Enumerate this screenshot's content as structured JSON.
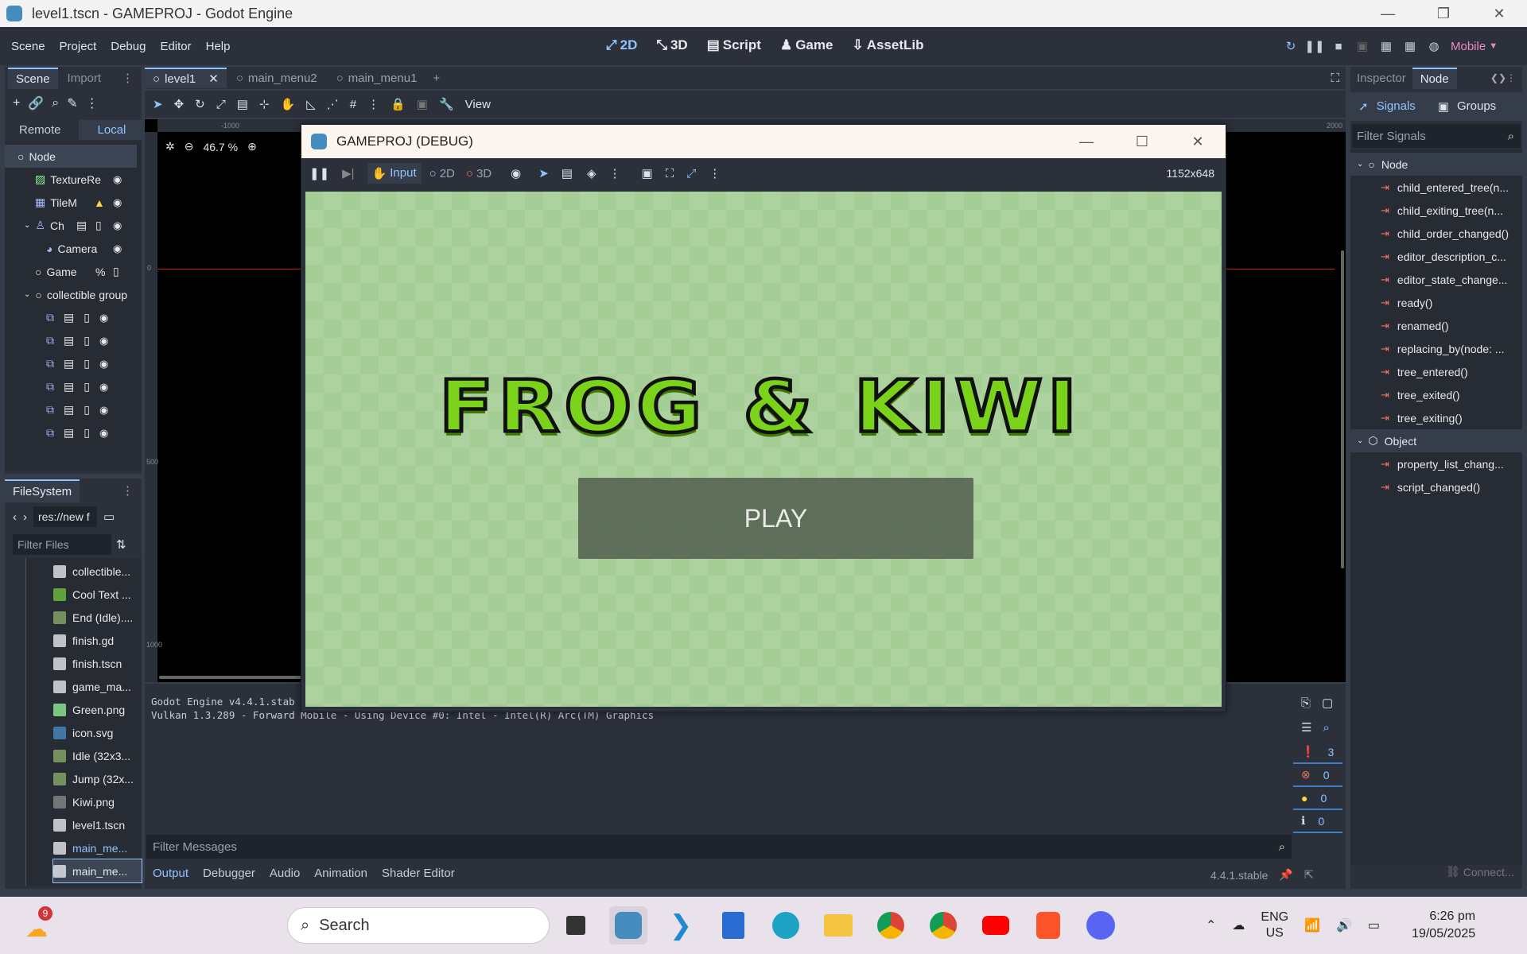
{
  "window": {
    "title": "level1.tscn - GAMEPROJ - Godot Engine"
  },
  "menu": [
    "Scene",
    "Project",
    "Debug",
    "Editor",
    "Help"
  ],
  "workspaces": [
    {
      "label": "2D",
      "active": true
    },
    {
      "label": "3D",
      "active": false
    },
    {
      "label": "Script",
      "active": false
    },
    {
      "label": "Game",
      "active": false
    },
    {
      "label": "AssetLib",
      "active": false
    }
  ],
  "renderer": "Mobile",
  "scene_dock": {
    "tabs": [
      "Scene",
      "Import"
    ],
    "remote": "Remote",
    "local": "Local",
    "nodes": [
      "Node",
      "TextureRe",
      "TileM",
      "Ch",
      "Camera",
      "Game",
      "collectible group"
    ]
  },
  "editor_tabs": [
    "level1",
    "main_menu2",
    "main_menu1"
  ],
  "canvas_toolbar": {
    "view": "View",
    "zoom": "46.7 %"
  },
  "rulers": {
    "top": [
      "-1000",
      "2000"
    ],
    "left": [
      "0",
      "500",
      "1000"
    ]
  },
  "game_window": {
    "title": "GAMEPROJ (DEBUG)",
    "input": "Input",
    "mode_2d": "2D",
    "mode_3d": "3D",
    "resolution": "1152x648",
    "logo_left": "FROG",
    "logo_amp": "&",
    "logo_right": "KIWI",
    "play": "PLAY"
  },
  "filesystem": {
    "tab": "FileSystem",
    "path": "res://new f",
    "filter_placeholder": "Filter Files",
    "files": [
      {
        "name": "collectible...",
        "color": "#e6e9ee"
      },
      {
        "name": "Cool Text ...",
        "color": "#e6e9ee"
      },
      {
        "name": "End (Idle)....",
        "color": "#e6e9ee"
      },
      {
        "name": "finish.gd",
        "color": "#e6e9ee"
      },
      {
        "name": "finish.tscn",
        "color": "#e6e9ee"
      },
      {
        "name": "game_ma...",
        "color": "#e6e9ee"
      },
      {
        "name": "Green.png",
        "color": "#e6e9ee"
      },
      {
        "name": "icon.svg",
        "color": "#e6e9ee"
      },
      {
        "name": "Idle (32x3...",
        "color": "#e6e9ee"
      },
      {
        "name": "Jump (32x...",
        "color": "#e6e9ee"
      },
      {
        "name": "Kiwi.png",
        "color": "#e6e9ee"
      },
      {
        "name": "level1.tscn",
        "color": "#e6e9ee"
      },
      {
        "name": "main_me...",
        "color": "#8fc5ff"
      },
      {
        "name": "main_me...",
        "color": "#e6e9ee"
      }
    ]
  },
  "output": {
    "lines": [
      "Godot Engine v4.4.1.stab",
      "Vulkan 1.3.289 - Forward Mobile - Using Device #0: Intel - Intel(R) Arc(TM) Graphics"
    ],
    "filter_placeholder": "Filter Messages",
    "counts": {
      "messages": "3",
      "errors": "0",
      "warnings": "0",
      "info": "0"
    }
  },
  "bottom_tabs": [
    "Output",
    "Debugger",
    "Audio",
    "Animation",
    "Shader Editor"
  ],
  "version": "4.4.1.stable",
  "inspector": {
    "tabs": [
      "Inspector",
      "Node"
    ],
    "subtabs": [
      "Signals",
      "Groups"
    ],
    "filter_placeholder": "Filter Signals",
    "node_header": "Node",
    "signals": [
      "child_entered_tree(n...",
      "child_exiting_tree(n...",
      "child_order_changed()",
      "editor_description_c...",
      "editor_state_change...",
      "ready()",
      "renamed()",
      "replacing_by(node: ...",
      "tree_entered()",
      "tree_exited()",
      "tree_exiting()"
    ],
    "object_header": "Object",
    "object_signals": [
      "property_list_chang...",
      "script_changed()"
    ],
    "connect": "Connect..."
  },
  "taskbar": {
    "weather_badge": "9",
    "search": "Search",
    "lang1": "ENG",
    "lang2": "US",
    "time": "6:26 pm",
    "date": "19/05/2025"
  }
}
